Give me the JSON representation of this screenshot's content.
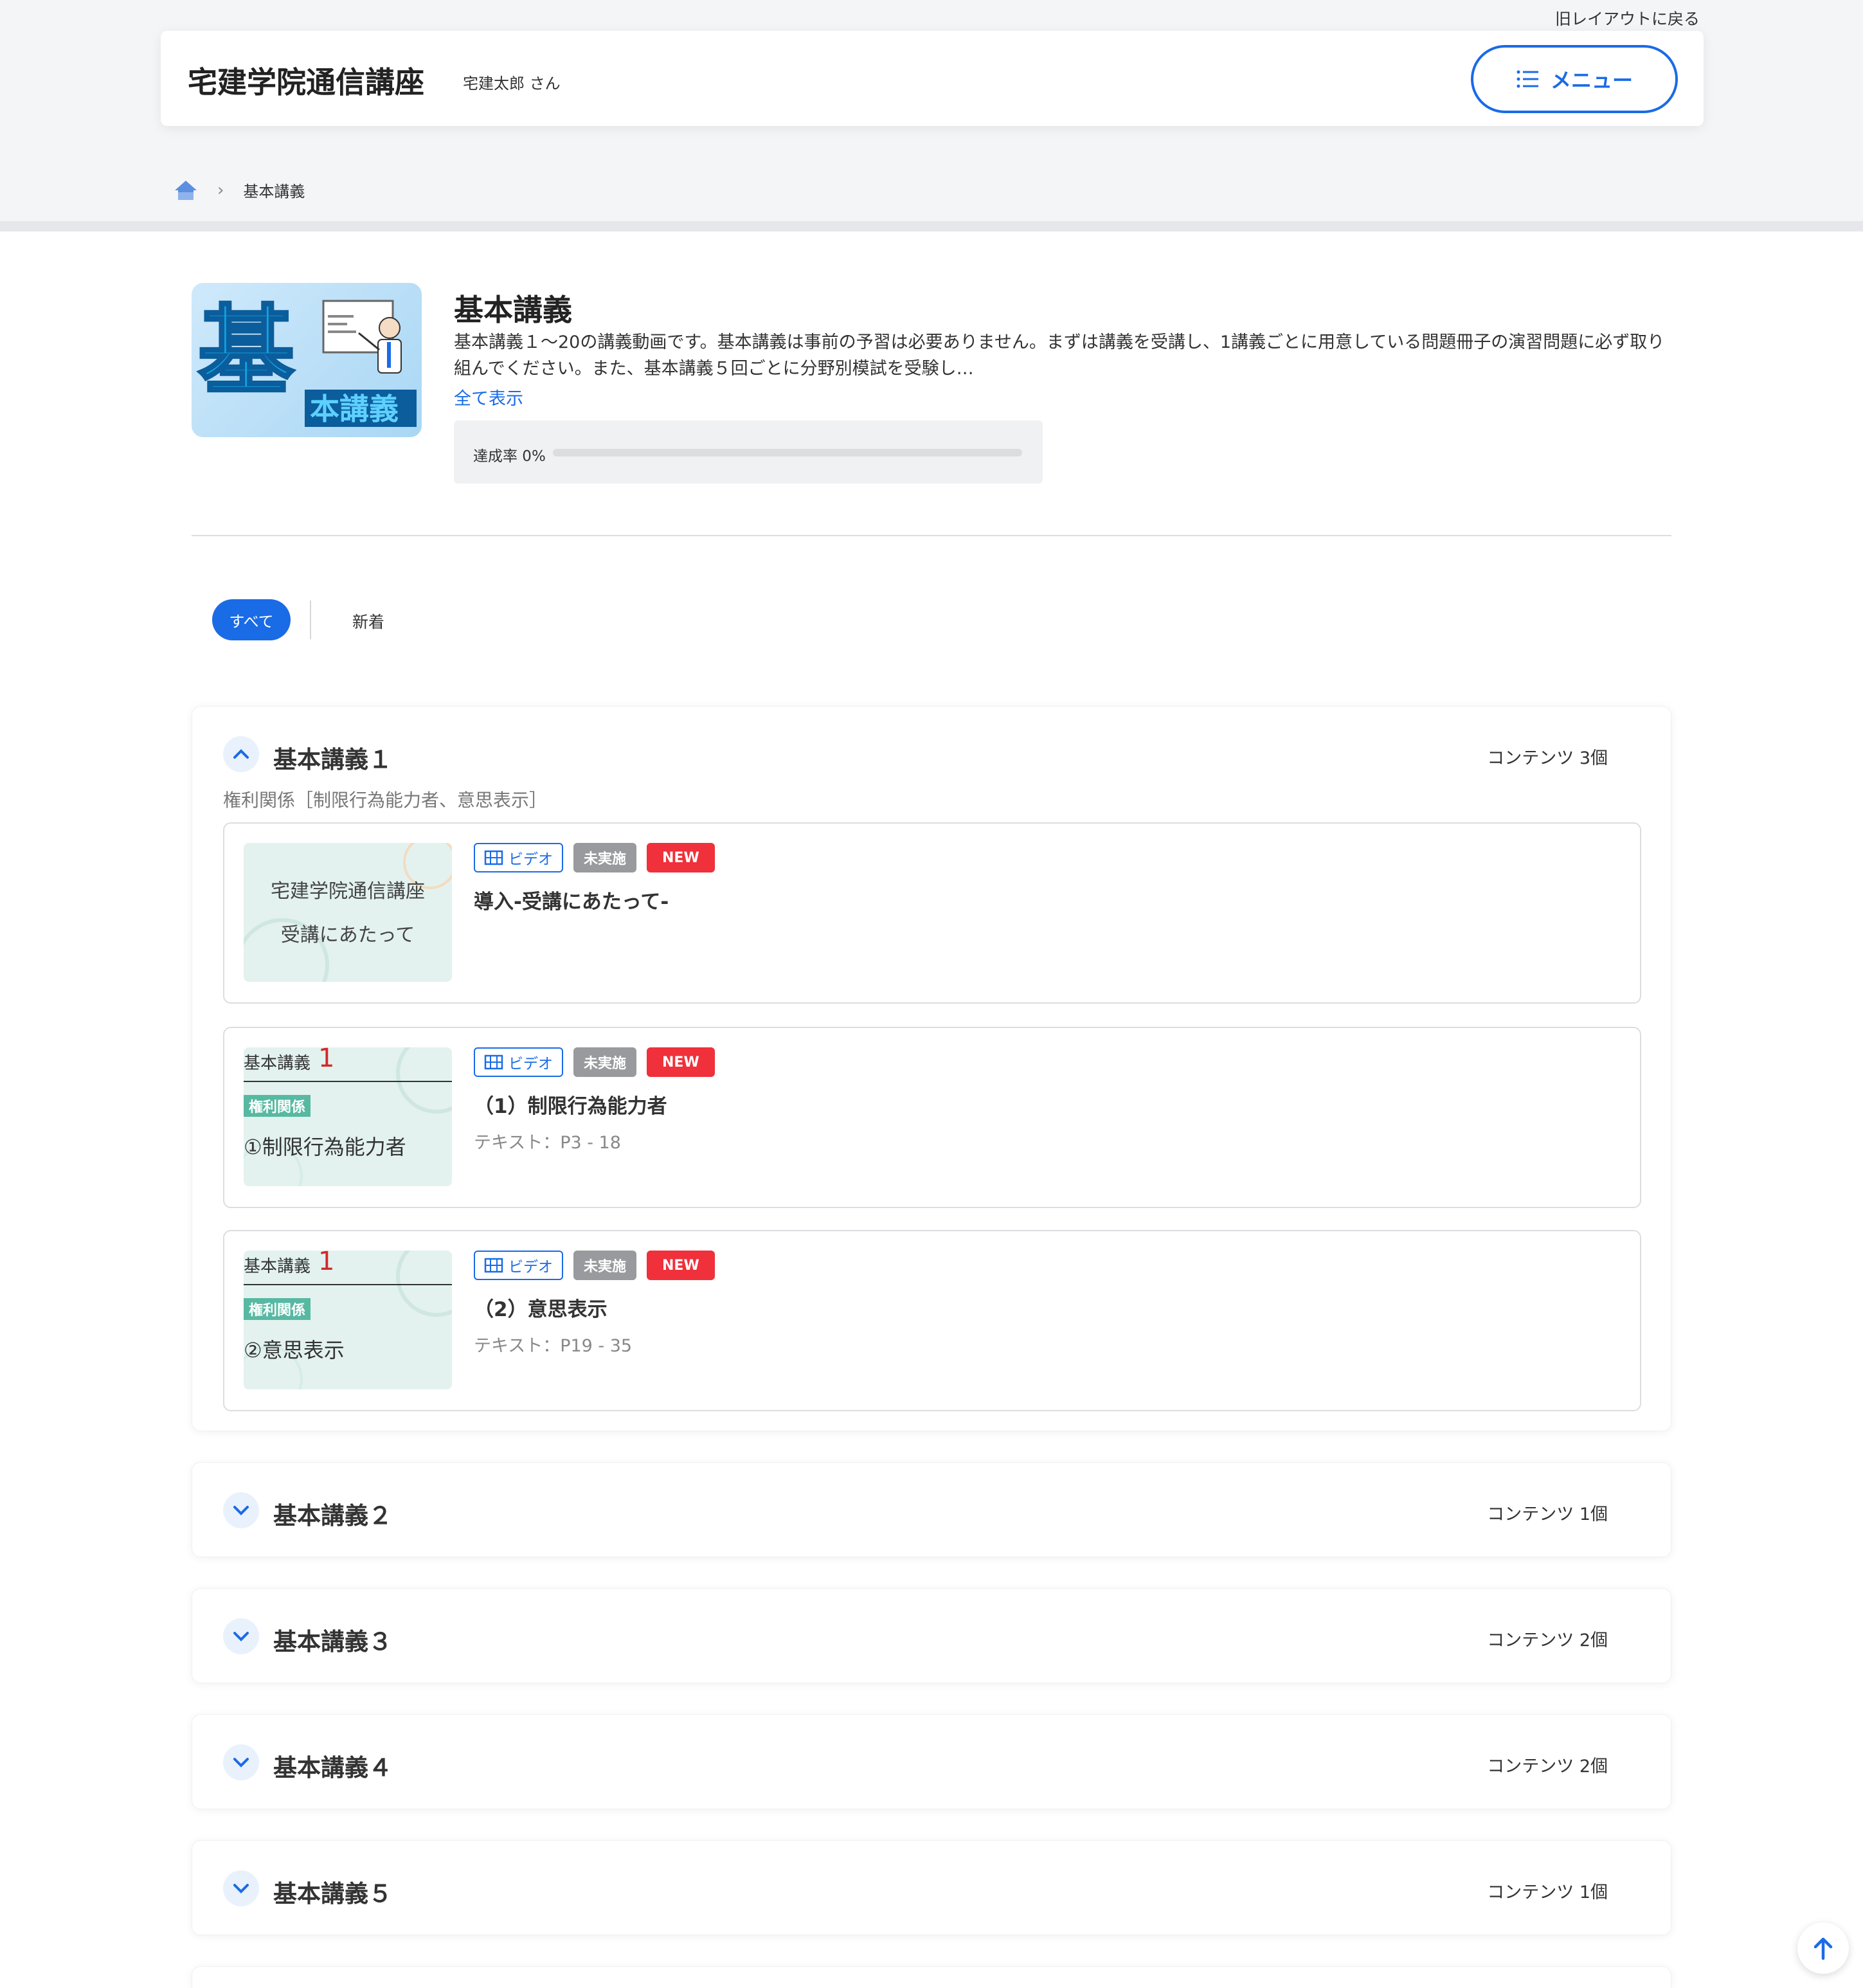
{
  "header": {
    "old_layout_link": "旧レイアウトに戻る",
    "site_title": "宅建学院通信講座",
    "user_name": "宅建太郎 さん",
    "menu_label": "メニュー"
  },
  "breadcrumb": {
    "current": "基本講義"
  },
  "course": {
    "title": "基本講義",
    "description": "基本講義１〜20の講義動画です。基本講義は事前の予習は必要ありません。まずは講義を受講し、1講義ごとに用意している問題冊子の演習問題に必ず取り組んでください。また、基本講義５回ごとに分野別模試を受験し…",
    "show_all": "全て表示",
    "progress_label": "達成率 0%",
    "progress_value": 0,
    "image_big_char": "基",
    "image_small_text": "本講義"
  },
  "filters": {
    "all": "すべて",
    "new": "新着"
  },
  "sections": [
    {
      "title": "基本講義１",
      "count": "コンテンツ 3個",
      "subtitle": "権利関係［制限行為能力者、意思表示］",
      "expanded": true,
      "items": [
        {
          "type_label": "ビデオ",
          "status_label": "未実施",
          "new_label": "NEW",
          "title": "導入-受講にあたって-",
          "text_ref": "",
          "thumb_line1": "宅建学院通信講座",
          "thumb_line2": "受講にあたって"
        },
        {
          "type_label": "ビデオ",
          "status_label": "未実施",
          "new_label": "NEW",
          "title": "（1）制限行為能力者",
          "text_ref": "テキスト：P3 - 18",
          "thumb_head": "基本講義",
          "thumb_num": "1",
          "thumb_badge": "権利関係",
          "thumb_sub": "①制限行為能力者"
        },
        {
          "type_label": "ビデオ",
          "status_label": "未実施",
          "new_label": "NEW",
          "title": "（2）意思表示",
          "text_ref": "テキスト：P19 - 35",
          "thumb_head": "基本講義",
          "thumb_num": "1",
          "thumb_badge": "権利関係",
          "thumb_sub": "②意思表示"
        }
      ]
    },
    {
      "title": "基本講義２",
      "count": "コンテンツ 1個",
      "expanded": false
    },
    {
      "title": "基本講義３",
      "count": "コンテンツ 2個",
      "expanded": false
    },
    {
      "title": "基本講義４",
      "count": "コンテンツ 2個",
      "expanded": false
    },
    {
      "title": "基本講義５",
      "count": "コンテンツ 1個",
      "expanded": false
    }
  ],
  "colors": {
    "accent": "#1a6be6",
    "new_badge": "#f0303a",
    "undone_badge": "#999a9d",
    "category_badge": "#57b9a2"
  }
}
